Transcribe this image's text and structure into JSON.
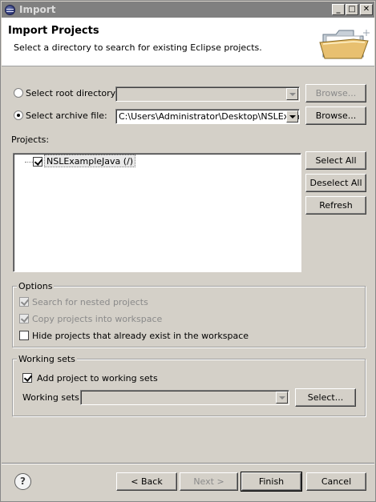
{
  "window": {
    "title": "Import",
    "min_glyph": "_",
    "max_glyph": "□",
    "close_glyph": "✕"
  },
  "banner": {
    "title": "Import Projects",
    "message": "Select a directory to search for existing Eclipse projects.",
    "icon": "folder-open-icon"
  },
  "source": {
    "root_dir_label": "Select root directory:",
    "root_dir_value": "",
    "root_dir_selected": false,
    "archive_label": "Select archive file:",
    "archive_value": "C:\\Users\\Administrator\\Desktop\\NSLExampl",
    "archive_selected": true,
    "browse_label": "Browse..."
  },
  "projects": {
    "label": "Projects:",
    "items": [
      {
        "label": "NSLExampleJava (/)",
        "checked": true
      }
    ],
    "select_all": "Select All",
    "deselect_all": "Deselect All",
    "refresh": "Refresh"
  },
  "options": {
    "title": "Options",
    "nested": {
      "label": "Search for nested projects",
      "checked": true,
      "enabled": false
    },
    "copy": {
      "label": "Copy projects into workspace",
      "checked": true,
      "enabled": false
    },
    "hide": {
      "label": "Hide projects that already exist in the workspace",
      "checked": false,
      "enabled": true
    }
  },
  "working_sets": {
    "title": "Working sets",
    "add_label": "Add project to working sets",
    "add_checked": true,
    "field_label": "Working sets:",
    "field_value": "",
    "select_button": "Select..."
  },
  "footer": {
    "help_glyph": "?",
    "back": "< Back",
    "next": "Next >",
    "finish": "Finish",
    "cancel": "Cancel"
  }
}
